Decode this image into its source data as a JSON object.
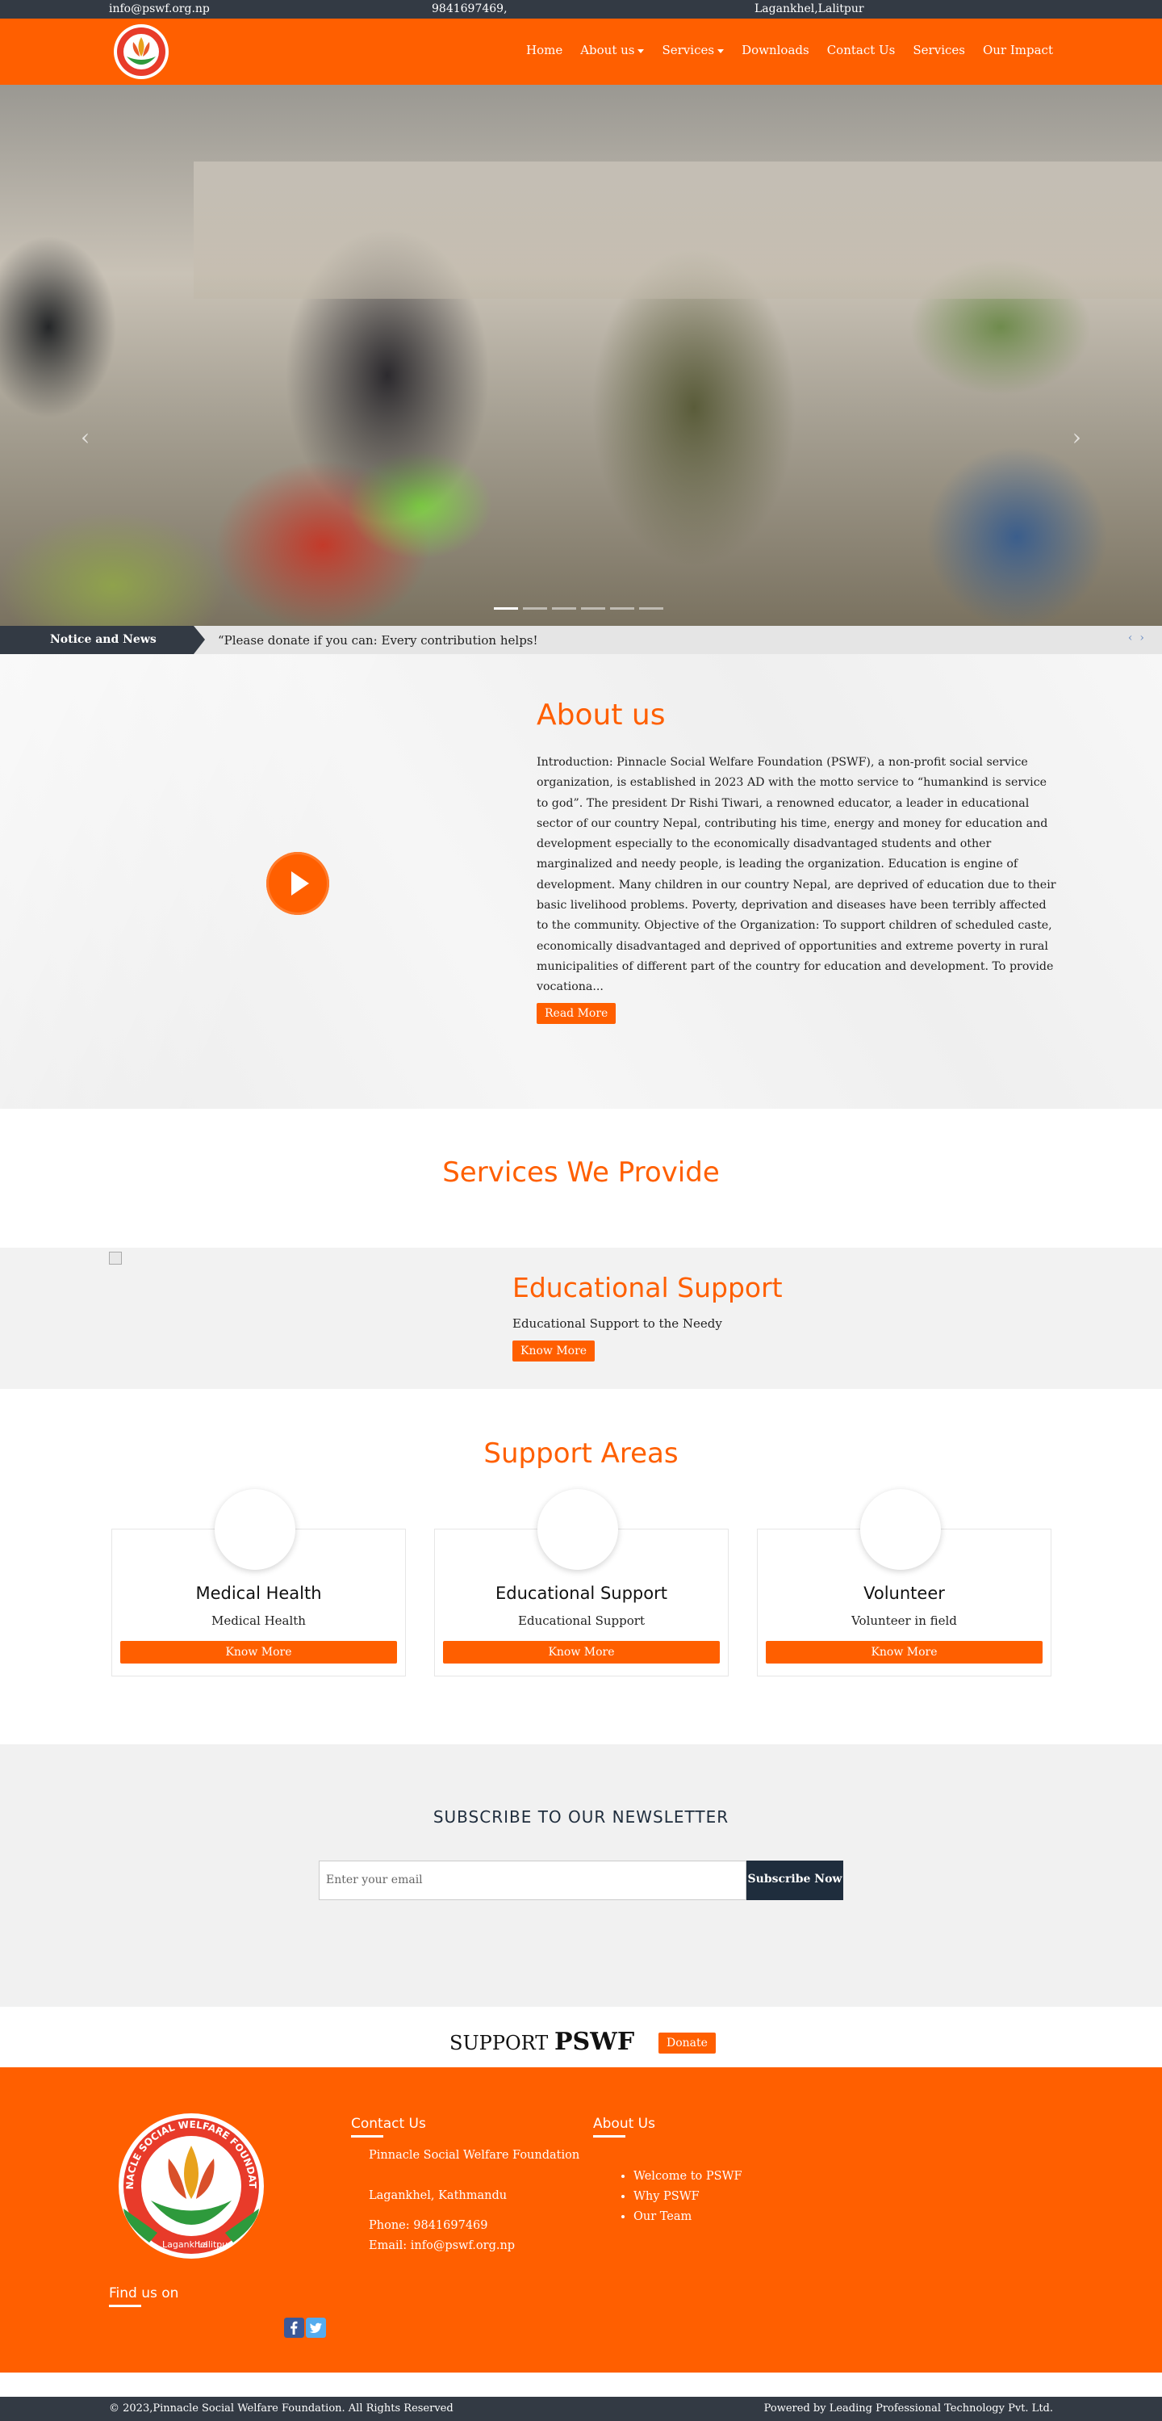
{
  "topbar": {
    "email": "info@pswf.org.np",
    "phone": "9841697469,",
    "address": "Lagankhel,Lalitpur"
  },
  "nav": {
    "home": "Home",
    "about": "About us",
    "services": "Services",
    "downloads": "Downloads",
    "contact": "Contact Us",
    "services2": "Services",
    "impact": "Our Impact"
  },
  "news": {
    "label": "Notice and News",
    "text": "“Please donate if you can: Every contribution helps!"
  },
  "about": {
    "title": "About us",
    "body": "Introduction:  Pinnacle Social Welfare Foundation (PSWF), a non-profit social service organization, is established in 2023 AD with the motto service to “humankind is service to god”. The president Dr Rishi Tiwari, a renowned educator, a leader in educational sector of our country Nepal, contributing his time, energy and money for  education and development especially to the economically disadvantaged students and other marginalized and needy people, is leading the organization.  Education is engine of development. Many children in our country Nepal, are deprived of education due to their basic livelihood problems. Poverty, deprivation and diseases have been terribly affected to the community.  Objective of the Organization: To support children of scheduled caste, economically disadvantaged and deprived of opportunities and extreme poverty in rural municipalities of different part of the country for education and development. To provide vocationa...",
    "read_more": "Read More"
  },
  "services": {
    "title": "Services We Provide",
    "item": {
      "title": "Educational Support",
      "desc": "Educational Support to the Needy",
      "button": "Know More"
    }
  },
  "support_areas": {
    "title": "Support Areas",
    "cards": [
      {
        "title": "Medical Health",
        "desc": "Medical Health",
        "button": "Know More"
      },
      {
        "title": "Educational Support",
        "desc": "Educational Support",
        "button": "Know More"
      },
      {
        "title": "Volunteer",
        "desc": "Volunteer in field",
        "button": "Know More"
      }
    ]
  },
  "newsletter": {
    "title": "SUBSCRIBE TO OUR NEWSLETTER",
    "placeholder": "Enter your email",
    "button": "Subscribe Now"
  },
  "donate": {
    "prefix": "SUPPORT",
    "brand": "PSWF",
    "button": "Donate"
  },
  "footer": {
    "logo_text_top": "PINNACLE SOCIAL WELFARE FOUNDATION",
    "logo_text_bottom_left": "Lagankhel",
    "logo_text_bottom_right": "Lalitpur",
    "contact_title": "Contact Us",
    "org_name": "Pinnacle Social Welfare Foundation",
    "address": "Lagankhel, Kathmandu",
    "phone": "Phone: 9841697469",
    "email": "Email: info@pswf.org.np",
    "about_title": "About Us",
    "about_links": [
      "Welcome to PSWF",
      "Why PSWF",
      "Our Team"
    ],
    "find_us": "Find us on"
  },
  "bottom": {
    "copyright": "© 2023,Pinnacle Social Welfare Foundation. All Rights Reserved",
    "powered": "Powered by Leading Professional Technology Pvt. Ltd."
  },
  "colors": {
    "brand": "#ff5f00",
    "dark": "#333a44",
    "navy": "#1f2d3d"
  }
}
